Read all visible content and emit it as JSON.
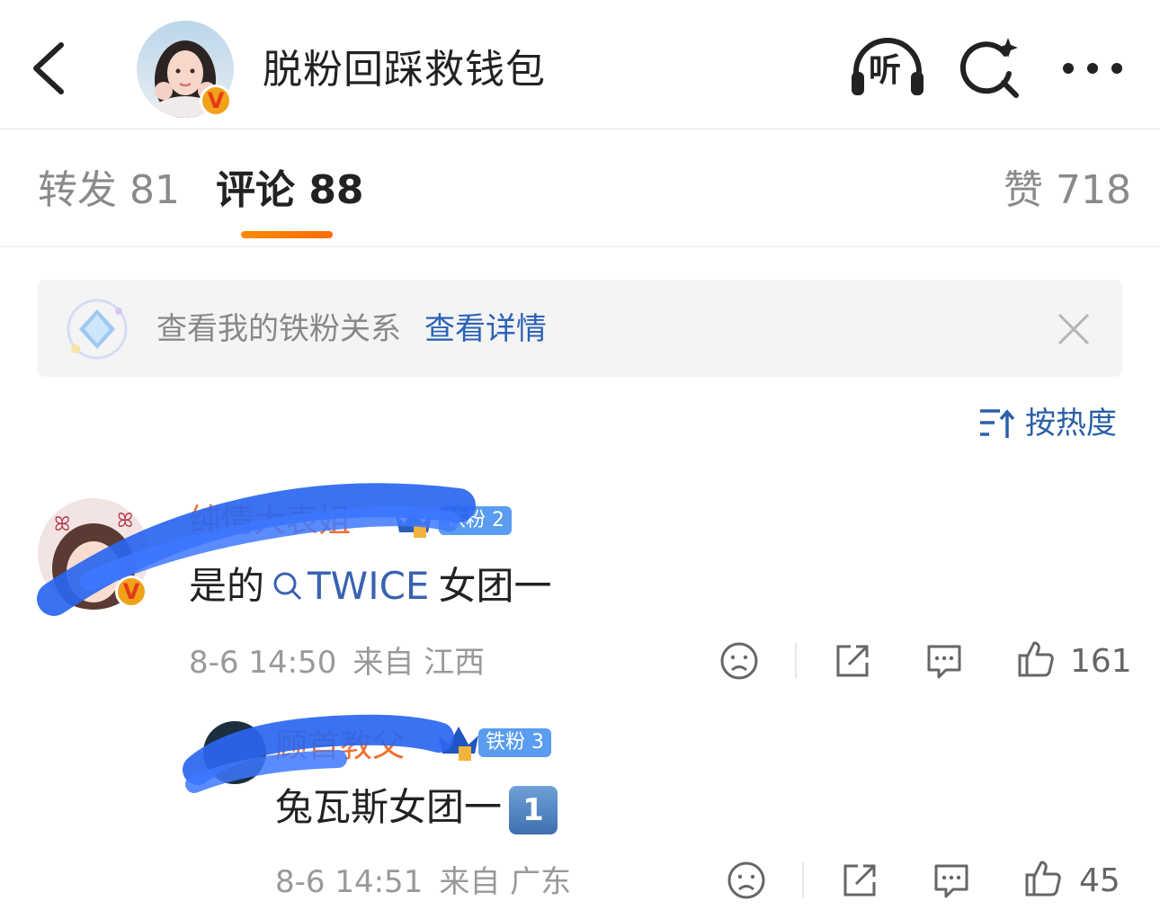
{
  "header": {
    "title": "脱粉回踩救钱包",
    "listen_label": "听",
    "verified_mark": "V"
  },
  "tabs": {
    "repost": "转发 81",
    "comments": "评论 88",
    "likes": "赞 718"
  },
  "banner": {
    "text": "查看我的铁粉关系",
    "link": "查看详情"
  },
  "sort": {
    "label": "按热度"
  },
  "comments": [
    {
      "user": "纯情大表姐",
      "fan_badge": "铁粉 2",
      "text_prefix": "是的",
      "topic": "TWICE",
      "text_suffix": "女团一",
      "time": "8-6 14:50",
      "location": "来自 江西",
      "likes": "161",
      "verified_mark": "V"
    },
    {
      "user": "顾首教父",
      "fan_badge": "铁粉 3",
      "text": "兔瓦斯女团一",
      "emoji": "1",
      "time": "8-6 14:51",
      "location": "来自 广东",
      "likes": "45"
    }
  ],
  "colors": {
    "accent_orange": "#ff7a00",
    "link_blue": "#2b62b6",
    "username_orange": "#f07030",
    "fan_badge_blue": "#5a9cf0"
  },
  "icons": [
    "back-arrow-icon",
    "listen-headphones-icon",
    "sparkle-search-icon",
    "more-dots-icon",
    "diamond-icon",
    "close-icon",
    "sort-icon",
    "sad-face-icon",
    "share-icon",
    "comment-icon",
    "like-thumb-icon",
    "crown-icon"
  ]
}
